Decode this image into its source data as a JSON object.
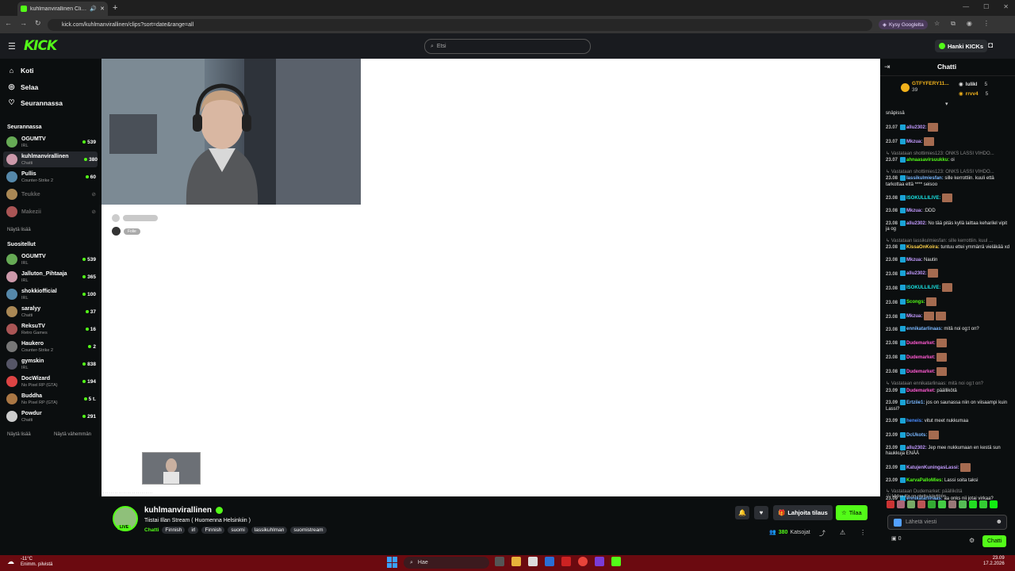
{
  "browser": {
    "tab_title": "kuhlmanvirallinen Clips - W",
    "url": "kick.com/kuhlmanvirallinen/clips?sort=date&range=all",
    "google_button": "Kysy Googlelta"
  },
  "header": {
    "logo": "KICK",
    "search_placeholder": "Etsi",
    "hanki_label": "Hanki KICKs"
  },
  "sidebar": {
    "nav": [
      {
        "label": "Koti",
        "icon": "home-icon"
      },
      {
        "label": "Selaa",
        "icon": "browse-icon"
      },
      {
        "label": "Seurannassa",
        "icon": "heart-icon"
      }
    ],
    "following_title": "Seurannassa",
    "following": [
      {
        "name": "OGUMTV",
        "category": "IRL",
        "viewers": "539",
        "live": true
      },
      {
        "name": "kuhlmanvirallinen",
        "category": "Chatti",
        "viewers": "380",
        "live": true
      },
      {
        "name": "Pullis",
        "category": "Counter-Strike 2",
        "viewers": "60",
        "live": true
      },
      {
        "name": "Teukke",
        "category": "",
        "viewers": "",
        "live": false
      },
      {
        "name": "Makezii",
        "category": "",
        "viewers": "",
        "live": false
      }
    ],
    "show_more": "Näytä lisää",
    "recommended_title": "Suositellut",
    "recommended": [
      {
        "name": "OGUMTV",
        "category": "IRL",
        "viewers": "539"
      },
      {
        "name": "Jalluton_Pihtaaja",
        "category": "IRL",
        "viewers": "365"
      },
      {
        "name": "shokkiofficial",
        "category": "IRL",
        "viewers": "100"
      },
      {
        "name": "saralyy",
        "category": "Chatti",
        "viewers": "37"
      },
      {
        "name": "ReksuTV",
        "category": "Retro Games",
        "viewers": "16"
      },
      {
        "name": "Haukero",
        "category": "Counter-Strike 2",
        "viewers": "2"
      },
      {
        "name": "gymskin",
        "category": "IRL",
        "viewers": "838"
      },
      {
        "name": "DocWizard",
        "category": "No Pixel RP (GTA)",
        "viewers": "194"
      },
      {
        "name": "Buddha",
        "category": "No Pixel RP (GTA)",
        "viewers": "5 t."
      },
      {
        "name": "Powdur",
        "category": "Chatti",
        "viewers": "291"
      }
    ],
    "rec_more": "Näytä lisää",
    "rec_less": "Näytä vähemmän"
  },
  "main": {
    "pill": "Folie"
  },
  "stream": {
    "channel": "kuhlmanvirallinen",
    "live_badge": "LIVE",
    "title": "Tiistai Illan Stream ( Huomenna Helsinkiin )",
    "category": "Chatti",
    "tags": [
      "Finnish",
      "irl",
      "Finnish",
      "suomi",
      "lassikuhlman",
      "suomistream"
    ],
    "gift_label": "Lahjoita tilaus",
    "sub_label": "Tilaa",
    "viewers": "380",
    "viewers_label": "Katsojat"
  },
  "chat": {
    "title": "Chatti",
    "pinned": [
      {
        "name": "GTFYFERY11...",
        "count": "39"
      },
      {
        "name": "lulikl",
        "count": "5"
      },
      {
        "name": "rrvv4",
        "count": "5"
      }
    ],
    "messages": [
      {
        "time": "",
        "user": "",
        "text": "snäpissä",
        "color": "#e8e8e8",
        "emotes": 0
      },
      {
        "time": "23.07",
        "user": "allu2302:",
        "text": "",
        "color": "#c39bff",
        "emotes": 1
      },
      {
        "time": "23.07",
        "user": "Mkzua:",
        "text": "",
        "color": "#c39bff",
        "emotes": 1
      },
      {
        "reply": "Vastataan shottimies123: ONKS LASSI VIHDO..."
      },
      {
        "time": "23.07",
        "user": "ahnaasavirsuukku:",
        "text": "oi",
        "color": "#53fc18",
        "emotes": 0
      },
      {
        "reply": "Vastataan shottimies123: ONKS LASSI VIHDO..."
      },
      {
        "time": "23.08",
        "user": "lassikulmiesfan:",
        "text": "sille kerrottiin. kuuli että tarkottaa että **** seisoo",
        "color": "#7ab8ff",
        "emotes": 0
      },
      {
        "time": "23.08",
        "user": "ISOKULLILIVE:",
        "text": "",
        "color": "#19e3e3",
        "emotes": 1
      },
      {
        "time": "23.08",
        "user": "Mkzua:",
        "text": ":DDD",
        "color": "#c39bff",
        "emotes": 0
      },
      {
        "time": "23.08",
        "user": "allu2302:",
        "text": "No tää pitäs kyllä laittaa keharilel vipit ja og",
        "color": "#c39bff",
        "emotes": 0
      },
      {
        "reply": "Vastataan lassikulmiesfan: sille kerrottiin. kuul ..."
      },
      {
        "time": "23.08",
        "user": "KissaOnKoira:",
        "text": "tuntuu ettei ymmärrä vieläkää xd",
        "color": "#ffd24a",
        "emotes": 0
      },
      {
        "time": "23.08",
        "user": "Mkzua:",
        "text": "Nautin",
        "color": "#c39bff",
        "emotes": 0
      },
      {
        "time": "23.08",
        "user": "allu2302:",
        "text": "",
        "color": "#c39bff",
        "emotes": 1
      },
      {
        "time": "23.08",
        "user": "ISOKULLILIVE:",
        "text": "",
        "color": "#19e3e3",
        "emotes": 1
      },
      {
        "time": "23.08",
        "user": "Scongs:",
        "text": "",
        "color": "#53fc18",
        "emotes": 1
      },
      {
        "time": "23.08",
        "user": "Mkzua:",
        "text": "",
        "color": "#c39bff",
        "emotes": 2
      },
      {
        "time": "23.08",
        "user": "ennikatarlinaas:",
        "text": "mitä noi og:t on?",
        "color": "#7ab8ff",
        "emotes": 0
      },
      {
        "time": "23.08",
        "user": "Dudemarket:",
        "text": "",
        "color": "#ff5ad2",
        "emotes": 1
      },
      {
        "time": "23.08",
        "user": "Dudemarket:",
        "text": "",
        "color": "#ff5ad2",
        "emotes": 1
      },
      {
        "time": "23.08",
        "user": "Dudemarket:",
        "text": "",
        "color": "#ff5ad2",
        "emotes": 1
      },
      {
        "reply": "Vastataan ennikatarlinaas: mitä noi og:t on?"
      },
      {
        "time": "23.09",
        "user": "Dudemarket:",
        "text": "päällikötä",
        "color": "#ff5ad2",
        "emotes": 0
      },
      {
        "time": "23.09",
        "user": "Ertziie1:",
        "text": "jos on saunassa niin on viisaampi kuin Lassi?",
        "color": "#7ab8ff",
        "emotes": 0
      },
      {
        "time": "23.09",
        "user": "heneis:",
        "text": "vitut meet nukkumaa",
        "color": "#4a8cff",
        "emotes": 0
      },
      {
        "time": "23.09",
        "user": "DcUkots:",
        "text": "",
        "color": "#7ab8ff",
        "emotes": 1
      },
      {
        "time": "23.09",
        "user": "allu2302:",
        "text": "Jep mee nukkumaan en kestä sun haukkuja ENÄÄ",
        "color": "#c39bff",
        "emotes": 0
      },
      {
        "time": "23.09",
        "user": "KatujenKuningasLassi:",
        "text": "",
        "color": "#c39bff",
        "emotes": 1
      },
      {
        "time": "23.09",
        "user": "KarvaPalloMies:",
        "text": "Lassi soita taksi",
        "color": "#53fc18",
        "emotes": 0
      },
      {
        "reply": "Vastataan Dudemarket: päällikötä"
      },
      {
        "time": "23.09",
        "user": "ennikatarlinaas:",
        "text": "aa onks nii jotai virkaa?",
        "color": "#7ab8ff",
        "emotes": 0
      }
    ],
    "hidden_note": "Hidas tila on otettu käyttöön.",
    "input_placeholder": "Lähetä viesti",
    "points": "0",
    "send_label": "Chatti"
  },
  "taskbar": {
    "temp": "-11°C",
    "weather": "Enimm. pilvistä",
    "search_placeholder": "Hae",
    "time": "23.09",
    "date": "17.2.2026"
  }
}
